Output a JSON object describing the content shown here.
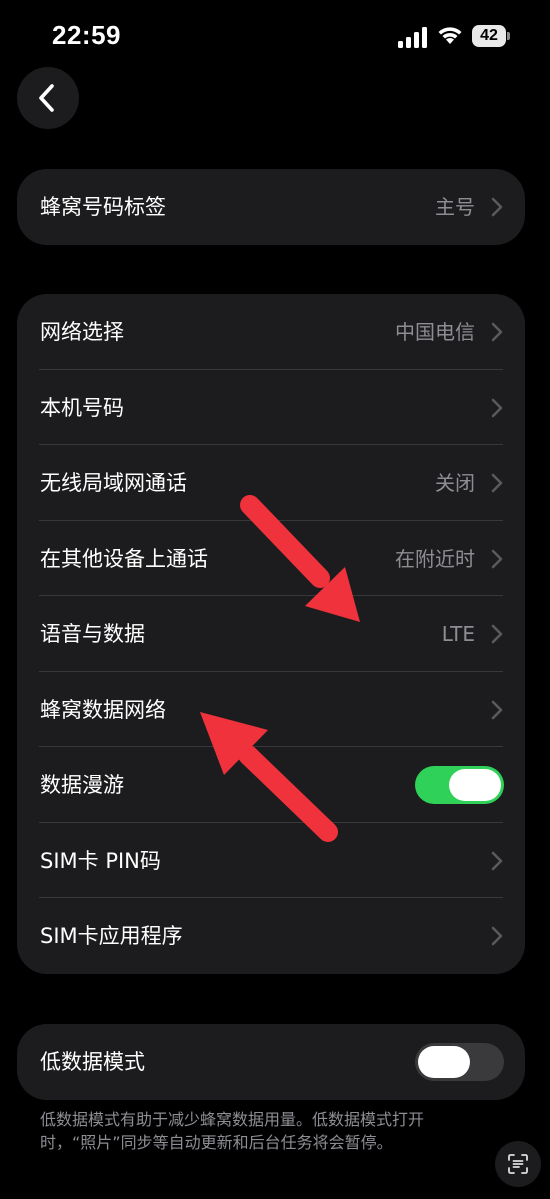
{
  "status_bar": {
    "time": "22:59",
    "battery_level": "42"
  },
  "colors": {
    "background": "#000000",
    "card": "#1c1c1e",
    "toggle_on": "#30d158",
    "toggle_off": "#3a3a3c",
    "secondary_text": "#8d8d93",
    "annotation_arrow": "#f0323c"
  },
  "nav": {
    "back_icon": "chevron-left-icon"
  },
  "section1": {
    "rows": [
      {
        "label": "蜂窝号码标签",
        "value": "主号"
      }
    ]
  },
  "section2": {
    "rows": [
      {
        "label": "网络选择",
        "value": "中国电信"
      },
      {
        "label": "本机号码",
        "value": ""
      },
      {
        "label": "无线局域网通话",
        "value": "关闭"
      },
      {
        "label": "在其他设备上通话",
        "value": "在附近时"
      },
      {
        "label": "语音与数据",
        "value": "LTE"
      },
      {
        "label": "蜂窝数据网络",
        "value": ""
      },
      {
        "label": "数据漫游",
        "toggle": "on"
      },
      {
        "label": "SIM卡 PIN码",
        "value": ""
      },
      {
        "label": "SIM卡应用程序",
        "value": ""
      }
    ]
  },
  "section3": {
    "rows": [
      {
        "label": "低数据模式",
        "toggle": "off"
      }
    ],
    "footnote": "低数据模式有助于减少蜂窝数据用量。低数据模式打开时，“照片”同步等自动更新和后台任务将会暂停。"
  }
}
